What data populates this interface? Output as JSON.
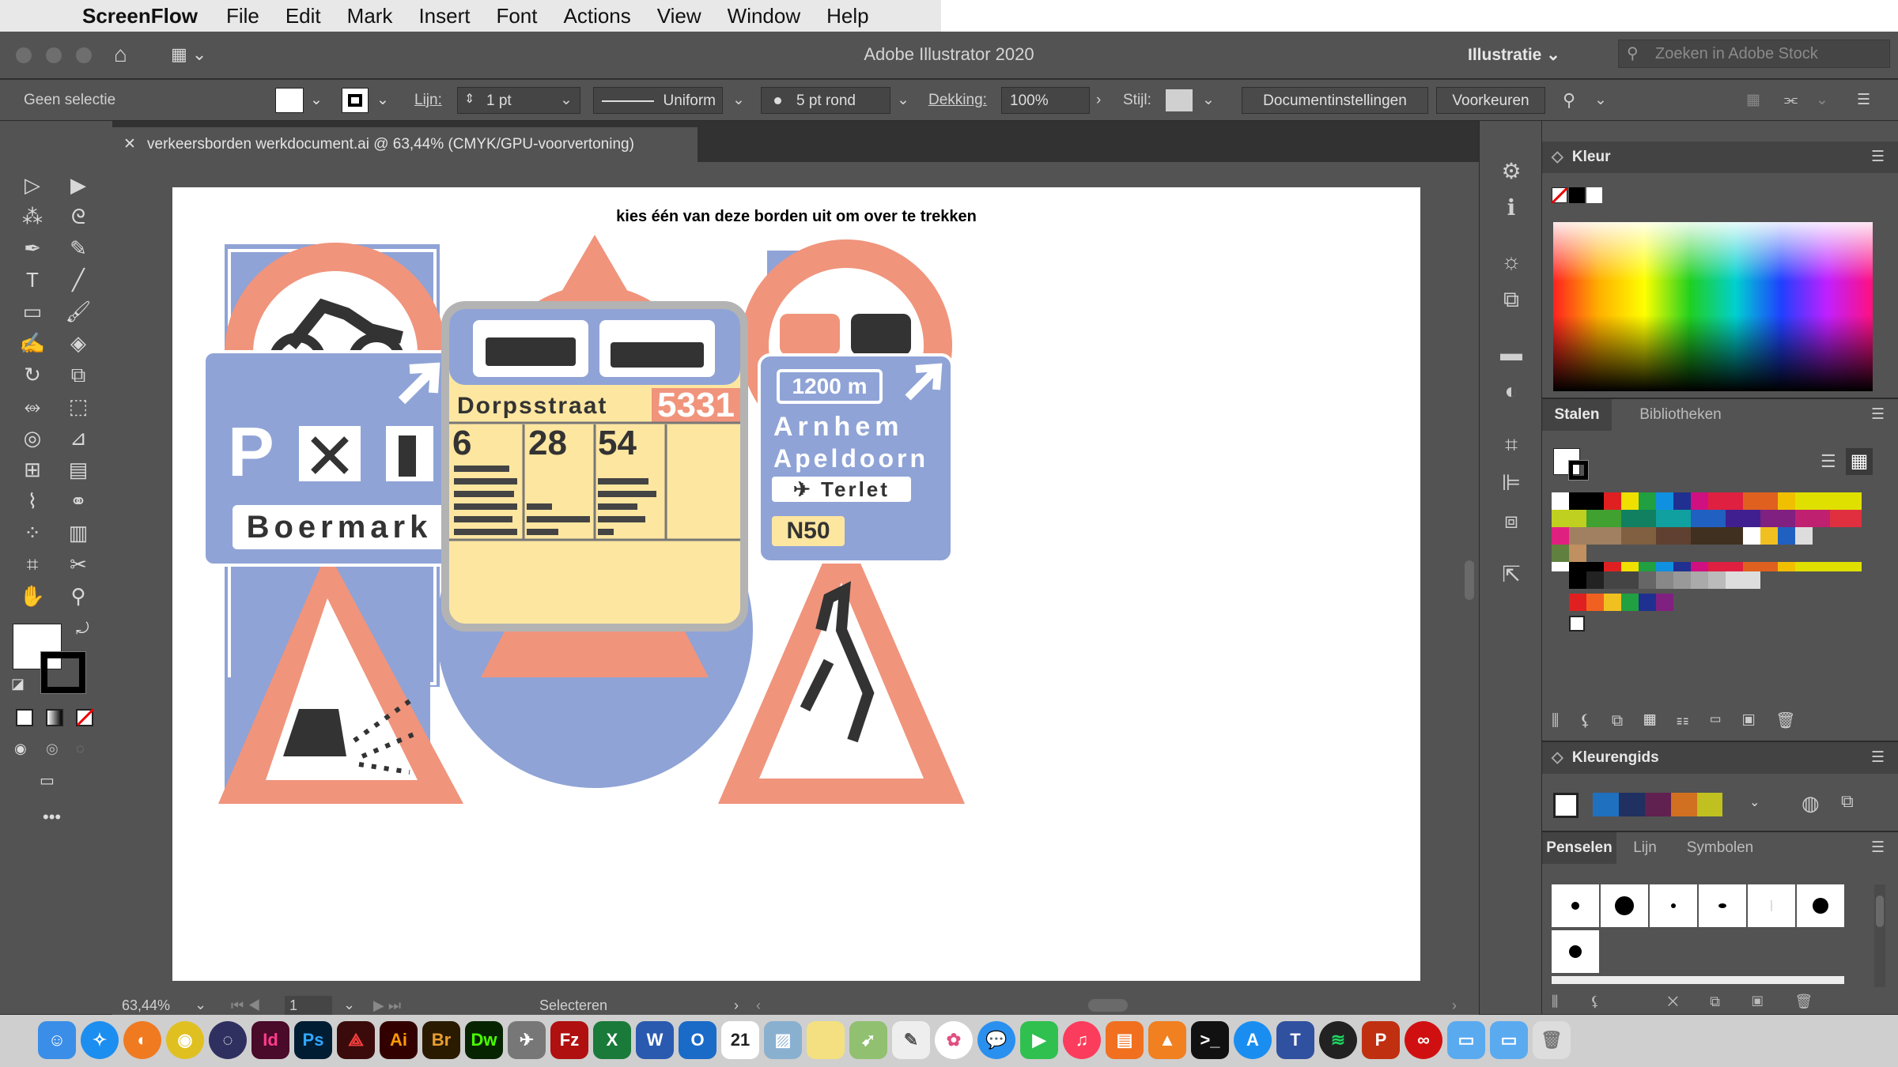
{
  "menubar": {
    "apple": "",
    "app_name": "ScreenFlow",
    "items": [
      "File",
      "Edit",
      "Mark",
      "Insert",
      "Font",
      "Actions",
      "View",
      "Window",
      "Help"
    ]
  },
  "titlebar": {
    "title": "Adobe Illustrator 2020",
    "workspace": "Illustratie",
    "stock_placeholder": "Zoeken in Adobe Stock"
  },
  "controlbar": {
    "selection": "Geen selectie",
    "stroke_label": "Lijn:",
    "stroke_value": "1 pt",
    "profile": "Uniform",
    "brush": "5 pt rond",
    "opacity_label": "Dekking:",
    "opacity_value": "100%",
    "style_label": "Stijl:",
    "doc_settings": "Documentinstellingen",
    "preferences": "Voorkeuren"
  },
  "document": {
    "tab_title": "verkeersborden werkdocument.ai @ 63,44% (CMYK/GPU-voorvertoning)",
    "artboard_text": "kies één van deze borden uit om over te trekken"
  },
  "signs": {
    "parking_label": "P",
    "parking_place": "Boermark",
    "bus_street": "Dorpsstraat",
    "bus_number": "5331",
    "bus_lines": [
      "6",
      "28",
      "54"
    ],
    "route_distance": "1200 m",
    "route_city1": "Arnhem",
    "route_city2": "Apeldoorn",
    "route_airport": "✈ Terlet",
    "route_road": "N50"
  },
  "statusbar": {
    "zoom": "63,44%",
    "artboard_num": "1",
    "tool": "Selecteren"
  },
  "panels": {
    "color_title": "Kleur",
    "swatches_tab": "Stalen",
    "libraries_tab": "Bibliotheken",
    "guide_title": "Kleurengids",
    "brushes_tab": "Penselen",
    "stroke_tab": "Lijn",
    "symbols_tab": "Symbolen"
  },
  "colors": {
    "sign_red": "#f0947c",
    "sign_blue": "#8fa3d6",
    "sign_yellow": "#fde6a0",
    "panel_bg": "#535353"
  },
  "dock": {
    "apps": [
      "finder",
      "safari",
      "firefox",
      "chrome",
      "siri",
      "indesign",
      "photoshop",
      "acrobat",
      "illustrator",
      "bridge",
      "dreamweaver",
      "launchpad",
      "filezilla",
      "excel",
      "word",
      "outlook",
      "calendar",
      "preview",
      "notes",
      "maps",
      "textedit",
      "photos",
      "messages",
      "facetime",
      "music",
      "books",
      "vlc",
      "terminal",
      "appstore",
      "teams",
      "spotify",
      "powerpoint",
      "creativecloud",
      "folder",
      "folder2",
      "trash"
    ],
    "calendar_day": "21"
  }
}
